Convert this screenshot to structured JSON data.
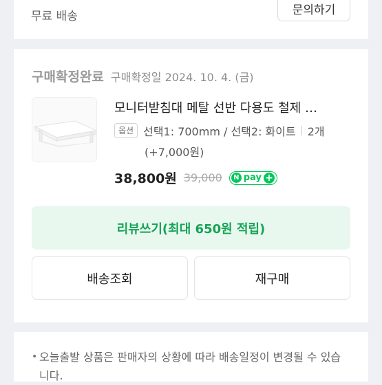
{
  "shipping": {
    "free_label": "무료 배송",
    "inquiry_button": "문의하기"
  },
  "order": {
    "status": "구매확정완료",
    "confirm_date": "구매확정일 2024. 10. 4. (금)"
  },
  "product": {
    "name": "모니터받침대 메탈 선반 다용도 철제 …",
    "option_badge": "옵션",
    "option_text": "선택1: 700mm / 선택2: 화이트",
    "quantity": "2개",
    "option_extra": "(+7,000원)",
    "price": "38,800원",
    "original_price": "39,000",
    "npay": {
      "n": "N",
      "text": "pay",
      "plus": "+"
    }
  },
  "actions": {
    "review": "리뷰쓰기(최대 650원 적립)",
    "track": "배송조회",
    "rebuy": "재구매"
  },
  "notice": {
    "text": "오늘출발 상품은 판매자의 상황에 따라 배송일정이 변경될 수 있습니다."
  },
  "colors": {
    "accent_green": "#03c75a",
    "review_bg": "#e9f8ef",
    "review_text": "#15a356"
  }
}
